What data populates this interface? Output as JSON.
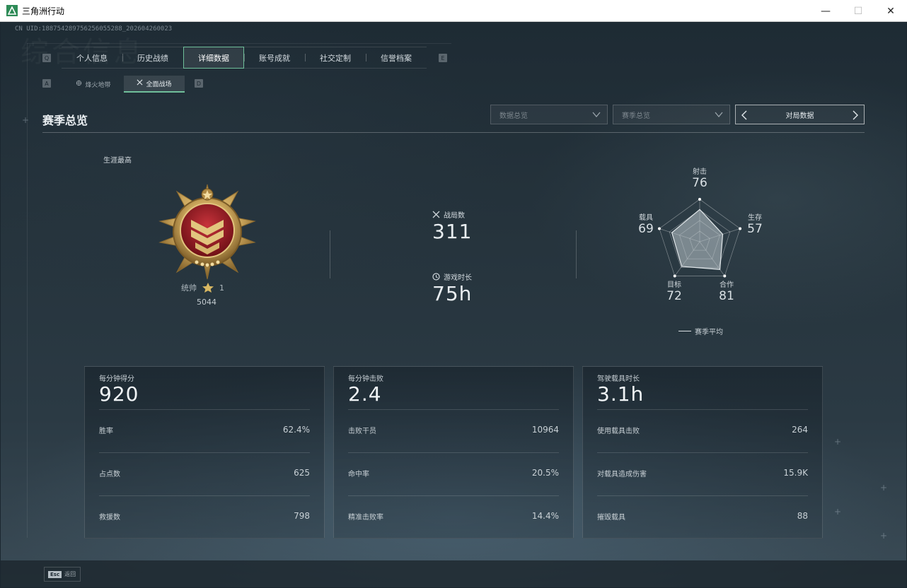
{
  "window": {
    "title": "三角洲行动",
    "minimize": "—",
    "maximize": "☐",
    "close": "✕"
  },
  "uid": "CN UID:188754289756256055288_202604260023",
  "deco_title": "综合信息",
  "key_hints": {
    "prev_tab": "Q",
    "next_tab": "E",
    "prev_sub": "A",
    "next_sub": "D"
  },
  "tabs": [
    {
      "label": "个人信息",
      "active": false
    },
    {
      "label": "历史战绩",
      "active": false
    },
    {
      "label": "详细数据",
      "active": true
    },
    {
      "label": "账号成就",
      "active": false
    },
    {
      "label": "社交定制",
      "active": false
    },
    {
      "label": "信誉档案",
      "active": false
    }
  ],
  "subtabs": [
    {
      "label": "烽火地带",
      "active": false
    },
    {
      "label": "全面战场",
      "active": true
    }
  ],
  "section_title": "赛季总览",
  "dropdowns": [
    {
      "label": "数据总览"
    },
    {
      "label": "赛季总览"
    }
  ],
  "nav_box": {
    "label": "对局数据"
  },
  "career": {
    "label": "生涯最高",
    "rank_name": "统帅",
    "rank_stars": "1",
    "rank_score": "5044"
  },
  "stats": {
    "matches_label": "战局数",
    "matches_value": "311",
    "playtime_label": "游戏时长",
    "playtime_value": "75h"
  },
  "radar": {
    "axes": [
      {
        "label": "射击",
        "value": "76"
      },
      {
        "label": "生存",
        "value": "57"
      },
      {
        "label": "合作",
        "value": "81"
      },
      {
        "label": "目标",
        "value": "72"
      },
      {
        "label": "载具",
        "value": "69"
      }
    ],
    "legend": "赛季平均"
  },
  "cards": [
    {
      "title": "每分钟得分",
      "big": "920",
      "rows": [
        {
          "label": "胜率",
          "value": "62.4%"
        },
        {
          "label": "占点数",
          "value": "625"
        },
        {
          "label": "救援数",
          "value": "798"
        }
      ]
    },
    {
      "title": "每分钟击败",
      "big": "2.4",
      "rows": [
        {
          "label": "击败干员",
          "value": "10964"
        },
        {
          "label": "命中率",
          "value": "20.5%"
        },
        {
          "label": "精准击败率",
          "value": "14.4%"
        }
      ]
    },
    {
      "title": "驾驶载具时长",
      "big": "3.1h",
      "rows": [
        {
          "label": "使用载具击败",
          "value": "264"
        },
        {
          "label": "对载具造成伤害",
          "value": "15.9K"
        },
        {
          "label": "摧毁载具",
          "value": "88"
        }
      ]
    }
  ],
  "footer": {
    "esc_key": "Esc",
    "esc_label": "返回"
  },
  "colors": {
    "accent": "#6fbf9a",
    "background": "#1b2730",
    "medal_gold": "#c9a45a",
    "medal_red": "#9b1c24"
  }
}
